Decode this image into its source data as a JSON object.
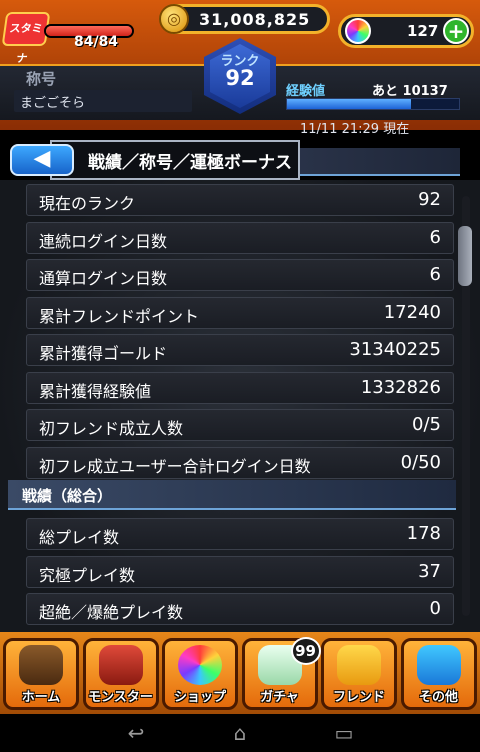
{
  "hud": {
    "stamina_label": "スタミナ",
    "stamina": "84/84",
    "stamina_fraction": 1.0,
    "gold_icon": "coin-icon",
    "gold": "31,008,825",
    "orbs": "127",
    "orb_plus": "+",
    "title_label": "称号",
    "player_name": "まごごそら",
    "rank_label": "ランク",
    "rank": "92",
    "exp_label": "経験値",
    "exp_remaining": "あと 10137",
    "exp_fraction": 0.72,
    "timestamp": "11/11 21:29 現在"
  },
  "header": {
    "back_icon": "back-arrow-icon",
    "back_glyph": "◀",
    "title": "戦績／称号／運極ボーナス"
  },
  "stats": [
    {
      "label": "現在のランク",
      "value": "92"
    },
    {
      "label": "連続ログイン日数",
      "value": "6"
    },
    {
      "label": "通算ログイン日数",
      "value": "6"
    },
    {
      "label": "累計フレンドポイント",
      "value": "17240"
    },
    {
      "label": "累計獲得ゴールド",
      "value": "31340225"
    },
    {
      "label": "累計獲得経験値",
      "value": "1332826"
    },
    {
      "label": "初フレンド成立人数",
      "value": "0/5"
    },
    {
      "label": "初フレ成立ユーザー合計ログイン日数",
      "value": "0/50"
    }
  ],
  "battle_section": {
    "title": "戦績（総合）",
    "rows": [
      {
        "label": "総プレイ数",
        "value": "178"
      },
      {
        "label": "究極プレイ数",
        "value": "37"
      },
      {
        "label": "超絶／爆絶プレイ数",
        "value": "0"
      }
    ]
  },
  "nav": [
    {
      "label": "ホーム",
      "icon": "home-icon"
    },
    {
      "label": "モンスター",
      "icon": "monster-icon"
    },
    {
      "label": "ショップ",
      "icon": "orb-shop-icon"
    },
    {
      "label": "ガチャ",
      "icon": "gacha-egg-icon",
      "badge": "99"
    },
    {
      "label": "フレンド",
      "icon": "friends-icon"
    },
    {
      "label": "その他",
      "icon": "other-question-icon"
    }
  ],
  "system_bar": {
    "back": "↩",
    "home": "⌂",
    "recents": "▭"
  }
}
